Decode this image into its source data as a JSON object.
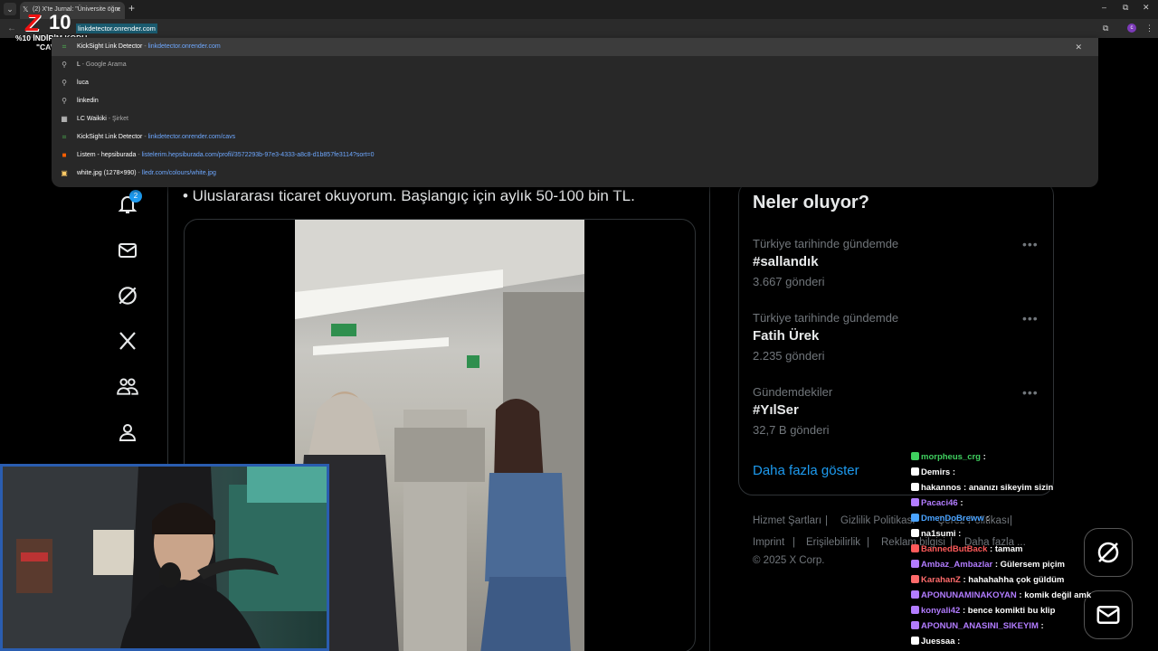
{
  "browser": {
    "tab_title": "(2) X'te Jurnal: \"Üniversite öğre",
    "url": "linkdetector.onrender.com"
  },
  "overlay": {
    "logo_letter": "Z",
    "logo_number": "10",
    "promo_line1": "%10 İNDİRİM KODU",
    "promo_line2": "\"CAVS\""
  },
  "omnibox_suggestions": [
    {
      "title": "KickSight Link Detector",
      "sep": " - ",
      "detail": "linkdetector.onrender.com",
      "style": "url",
      "icon": "globe-icon"
    },
    {
      "title": "L",
      "sep": " - ",
      "detail": "Google Arama",
      "style": "dim",
      "icon": "search-icon"
    },
    {
      "title": "luca",
      "sep": "",
      "detail": "",
      "style": "dim",
      "icon": "search-icon"
    },
    {
      "title": "linkedin",
      "sep": "",
      "detail": "",
      "style": "dim",
      "icon": "search-icon"
    },
    {
      "title": "LC Waikiki",
      "sep": " - ",
      "detail": "Şirket",
      "style": "dim",
      "icon": "company-icon"
    },
    {
      "title": "KickSight Link Detector",
      "sep": " - ",
      "detail": "linkdetector.onrender.com/cavs",
      "style": "url",
      "icon": "globe-icon"
    },
    {
      "title": "Listem - hepsiburada",
      "sep": " - ",
      "detail": "listelerim.hepsiburada.com/profil/3572293b-97e3-4333-a8c8-d1b857fe3114?sort=0",
      "style": "url",
      "icon": "hepsiburada-icon"
    },
    {
      "title": "white.jpg (1278×990)",
      "sep": " - ",
      "detail": "lledr.com/colours/white.jpg",
      "style": "url",
      "icon": "image-icon"
    }
  ],
  "nav": {
    "notifications_count": "2"
  },
  "tweet": {
    "text": "• Uluslararası ticaret okuyorum. Başlangıç için aylık 50-100 bin TL."
  },
  "trends": {
    "title": "Neler oluyor?",
    "items": [
      {
        "context": "Türkiye tarihinde gündemde",
        "name": "#sallandık",
        "count": "3.667 gönderi"
      },
      {
        "context": "Türkiye tarihinde gündemde",
        "name": "Fatih Ürek",
        "count": "2.235 gönderi"
      },
      {
        "context": "Gündemdekiler",
        "name": "#YılSer",
        "count": "32,7 B gönderi"
      }
    ],
    "show_more": "Daha fazla göster"
  },
  "footer": {
    "terms": "Hizmet Şartları",
    "privacy": "Gizlilik Politikası",
    "cookies": "Çerez Politikası",
    "imprint": "Imprint",
    "accessibility": "Erişilebilirlik",
    "ads": "Reklam bilgisi",
    "more": "Daha fazla ...",
    "copyright": "© 2025 X Corp."
  },
  "chat": [
    {
      "user": "morpheus_crg",
      "msg": "",
      "color": "#3fcf5f"
    },
    {
      "user": "Demirs",
      "msg": "",
      "color": "#ffffff"
    },
    {
      "user": "hakannos",
      "msg": "ananızı sikeyim sizin",
      "color": "#ffffff"
    },
    {
      "user": "Pacaci46",
      "msg": "",
      "color": "#b27cff"
    },
    {
      "user": "DmenDoBreww",
      "msg": "",
      "color": "#4aa3ff"
    },
    {
      "user": "na1sumi",
      "msg": "",
      "color": "#ffffff"
    },
    {
      "user": "BannedButBack",
      "msg": "tamam",
      "color": "#ff5a5a"
    },
    {
      "user": "Ambaz_Ambazlar",
      "msg": "Gülersem piçim",
      "color": "#b27cff"
    },
    {
      "user": "KarahanZ",
      "msg": "hahahahha çok güldüm",
      "color": "#ff6b6b"
    },
    {
      "user": "APONUNAMINAKOYAN",
      "msg": "komik değil amk",
      "color": "#b27cff"
    },
    {
      "user": "konyali42",
      "msg": "bence komikti bu klip",
      "color": "#b27cff"
    },
    {
      "user": "APONUN_ANASINI_SIKEYIM",
      "msg": "",
      "color": "#b27cff"
    },
    {
      "user": "Juessaa",
      "msg": "",
      "color": "#ffffff"
    }
  ],
  "colors": {
    "accent": "#1d9bf0",
    "background": "#000000",
    "muted_text": "#71767b",
    "border": "#2f3336"
  }
}
